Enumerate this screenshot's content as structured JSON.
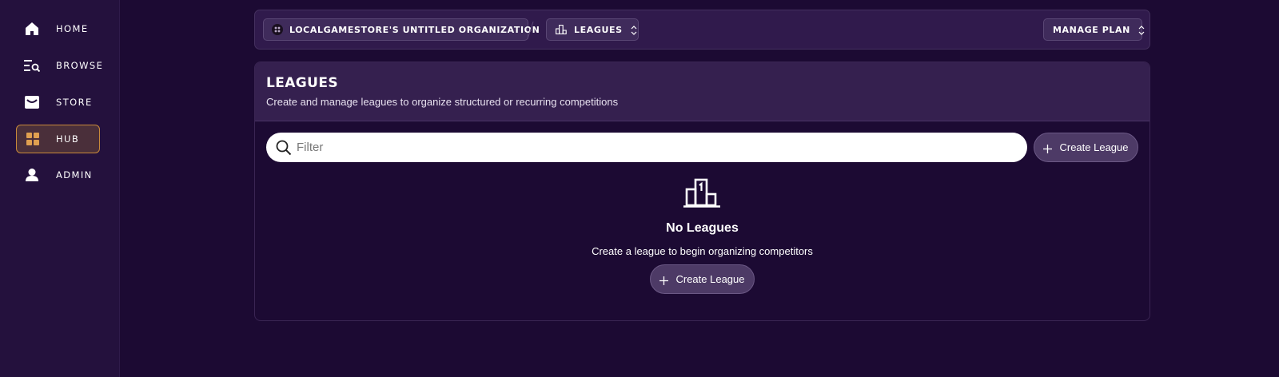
{
  "sidebar": {
    "items": [
      {
        "label": "HOME",
        "icon": "home-icon"
      },
      {
        "label": "BROWSE",
        "icon": "browse-icon"
      },
      {
        "label": "STORE",
        "icon": "store-icon"
      },
      {
        "label": "HUB",
        "icon": "hub-grid-icon",
        "active": true
      },
      {
        "label": "ADMIN",
        "icon": "user-icon"
      }
    ]
  },
  "topbar": {
    "organization": "LOCALGAMESTORE'S UNTITLED ORGANIZATION",
    "section": "LEAGUES",
    "manage_plan": "MANAGE PLAN"
  },
  "page": {
    "title": "LEAGUES",
    "subtitle": "Create and manage leagues to organize structured or recurring competitions"
  },
  "filter": {
    "placeholder": "Filter",
    "value": ""
  },
  "create_button_label": "Create League",
  "empty_state": {
    "icon": "podium-icon",
    "title": "No Leagues",
    "message": "Create a league to begin organizing competitors",
    "button_label": "Create League"
  },
  "colors": {
    "background": "#1c0a33",
    "sidebar": "#24113d",
    "accent_active_border": "#c98a3a",
    "hub_icon": "#e0a050"
  }
}
